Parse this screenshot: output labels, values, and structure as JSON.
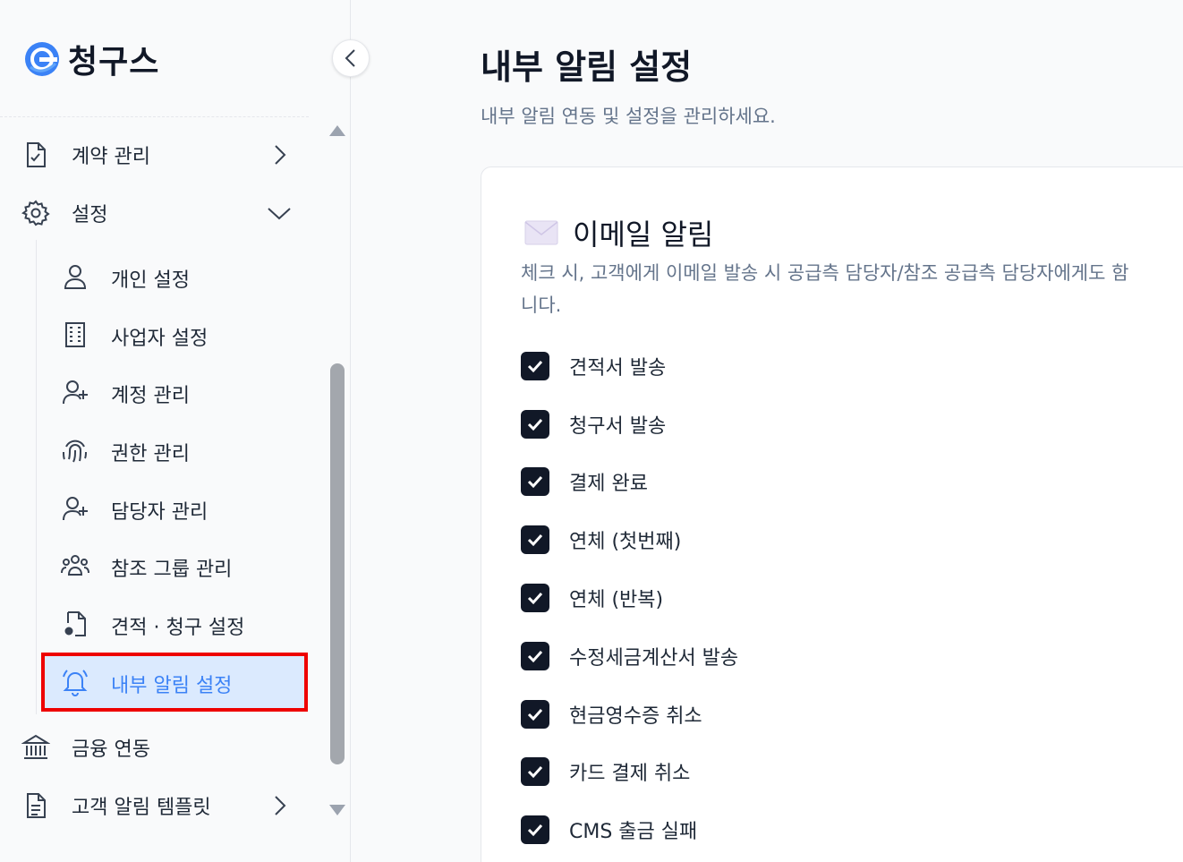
{
  "brand": {
    "name": "청구스"
  },
  "sidebar": {
    "items": [
      {
        "label": "계약 관리",
        "icon": "contract-file-icon",
        "chevron": "right"
      },
      {
        "label": "설정",
        "icon": "gear-icon",
        "chevron": "down"
      }
    ],
    "settings_sub": [
      {
        "label": "개인 설정",
        "icon": "user-icon"
      },
      {
        "label": "사업자 설정",
        "icon": "building-icon"
      },
      {
        "label": "계정 관리",
        "icon": "user-plus-icon"
      },
      {
        "label": "권한 관리",
        "icon": "fingerprint-icon"
      },
      {
        "label": "담당자 관리",
        "icon": "user-plus-icon"
      },
      {
        "label": "참조 그룹 관리",
        "icon": "users-group-icon"
      },
      {
        "label": "견적 · 청구 설정",
        "icon": "file-gear-icon"
      },
      {
        "label": "내부 알림 설정",
        "icon": "bell-icon",
        "active": true
      }
    ],
    "bottom_items": [
      {
        "label": "금융 연동",
        "icon": "bank-icon"
      },
      {
        "label": "고객 알림 템플릿",
        "icon": "document-icon",
        "chevron": "right"
      }
    ]
  },
  "main": {
    "title": "내부 알림 설정",
    "subtitle": "내부 알림 연동 및 설정을 관리하세요.",
    "email_card": {
      "title": "이메일 알림",
      "description": "체크 시, 고객에게 이메일 발송 시 공급측 담당자/참조 공급측 담당자에게도 함께 발송됩니다.",
      "description_visible_line1": "체크 시, 고객에게 이메일 발송 시 공급측 담당자/참조 공급측 담당자에게도 함",
      "description_visible_line2": "니다.",
      "options": [
        {
          "label": "견적서 발송",
          "checked": true
        },
        {
          "label": "청구서 발송",
          "checked": true
        },
        {
          "label": "결제 완료",
          "checked": true
        },
        {
          "label": "연체 (첫번째)",
          "checked": true
        },
        {
          "label": "연체 (반복)",
          "checked": true
        },
        {
          "label": "수정세금계산서 발송",
          "checked": true
        },
        {
          "label": "현금영수증 취소",
          "checked": true
        },
        {
          "label": "카드 결제 취소",
          "checked": true
        },
        {
          "label": "CMS 출금 실패",
          "checked": true
        }
      ]
    }
  },
  "colors": {
    "accent": "#3b82f6",
    "active_bg": "#dbeafe",
    "highlight_border": "#e00000",
    "checkbox": "#111827"
  }
}
